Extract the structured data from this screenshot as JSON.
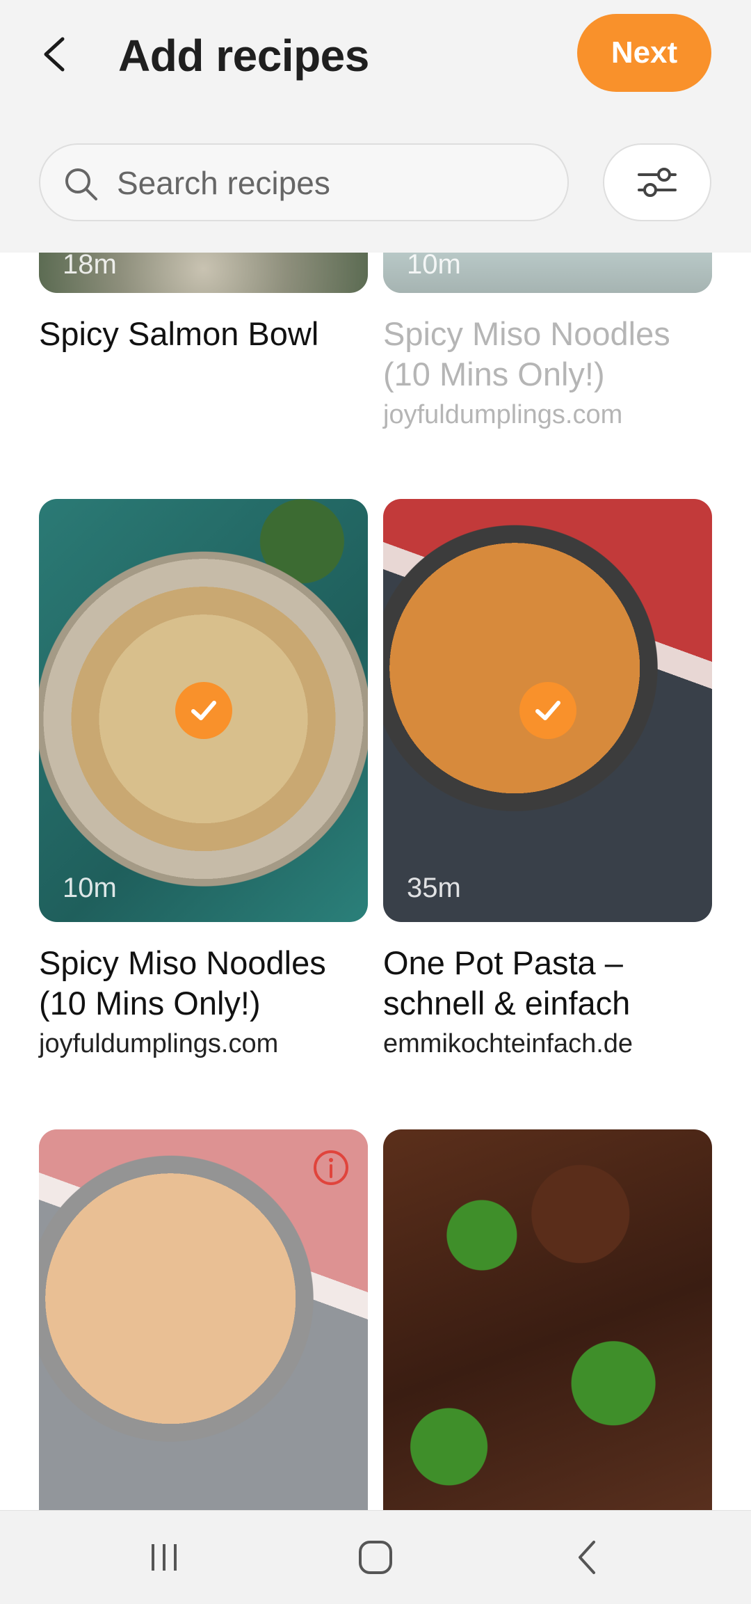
{
  "header": {
    "title": "Add recipes",
    "next_label": "Next"
  },
  "search": {
    "placeholder": "Search recipes",
    "value": ""
  },
  "recipes": [
    {
      "title": "Spicy Salmon Bowl",
      "source": "",
      "duration": "18m",
      "selected": false,
      "disabled": false
    },
    {
      "title": "Spicy Miso Noodles (10 Mins Only!)",
      "source": "joyfuldumplings.com",
      "duration": "10m",
      "selected": false,
      "disabled": true
    },
    {
      "title": "Spicy Miso Noodles (10 Mins Only!)",
      "source": "joyfuldumplings.com",
      "duration": "10m",
      "selected": true,
      "disabled": false
    },
    {
      "title": "One Pot Pasta – schnell & einfach",
      "source": "emmikochteinfach.de",
      "duration": "35m",
      "selected": true,
      "disabled": false
    },
    {
      "title": "",
      "source": "",
      "duration": "",
      "selected": false,
      "disabled": true,
      "info": true
    },
    {
      "title": "",
      "source": "",
      "duration": "",
      "selected": false,
      "disabled": false
    }
  ],
  "colors": {
    "accent": "#f9912b",
    "info_red": "#e0443c"
  },
  "icons": {
    "back": "back-arrow-icon",
    "search": "search-icon",
    "filter": "filter-sliders-icon",
    "check": "check-icon",
    "info": "info-icon",
    "nav_recents": "recents-icon",
    "nav_home": "home-icon",
    "nav_back": "nav-back-icon"
  }
}
